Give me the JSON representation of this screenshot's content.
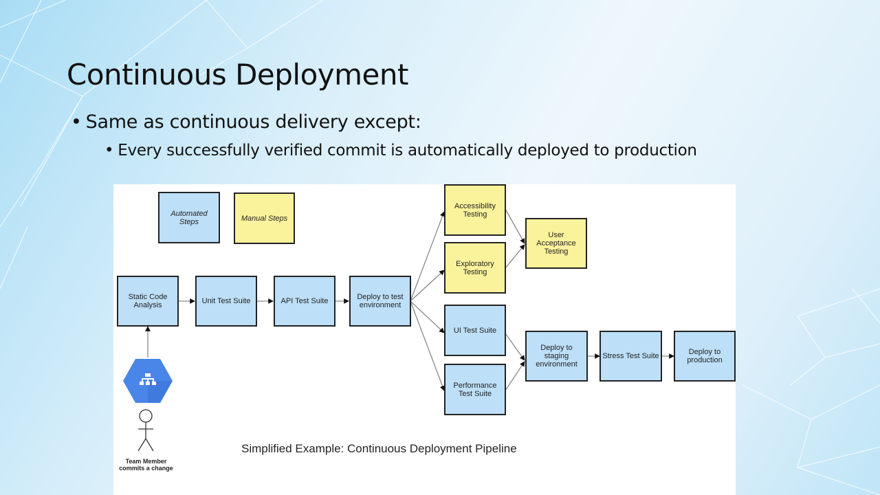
{
  "slide": {
    "title": "Continuous Deployment",
    "bullets": [
      {
        "level": 1,
        "text": "Same as continuous delivery except:"
      },
      {
        "level": 2,
        "text": "Every successfully verified commit is automatically deployed to production"
      }
    ]
  },
  "colors": {
    "automated": "#bddff8",
    "manual": "#fbf39b",
    "hexagon": "#4a86e8"
  },
  "diagram": {
    "legend": {
      "automated_label": "Automated Steps",
      "manual_label": "Manual Steps"
    },
    "nodes": {
      "static_code_analysis": "Static Code Analysis",
      "unit_test_suite": "Unit Test Suite",
      "api_test_suite": "API Test Suite",
      "deploy_test": "Deploy to test environment",
      "accessibility_testing": "Accessibility Testing",
      "exploratory_testing": "Exploratory Testing",
      "user_acceptance_testing": "User Acceptance Testing",
      "ui_test_suite": "UI Test Suite",
      "performance_test_suite": "Performance Test Suite",
      "deploy_staging": "Deploy to staging environment",
      "stress_test_suite": "Stress Test Suite",
      "deploy_production": "Deploy to production"
    },
    "source_icon": "network-hub-icon",
    "actor_label_line1": "Team Member",
    "actor_label_line2": "commits a change",
    "caption": "Simplified Example: Continuous Deployment Pipeline"
  }
}
